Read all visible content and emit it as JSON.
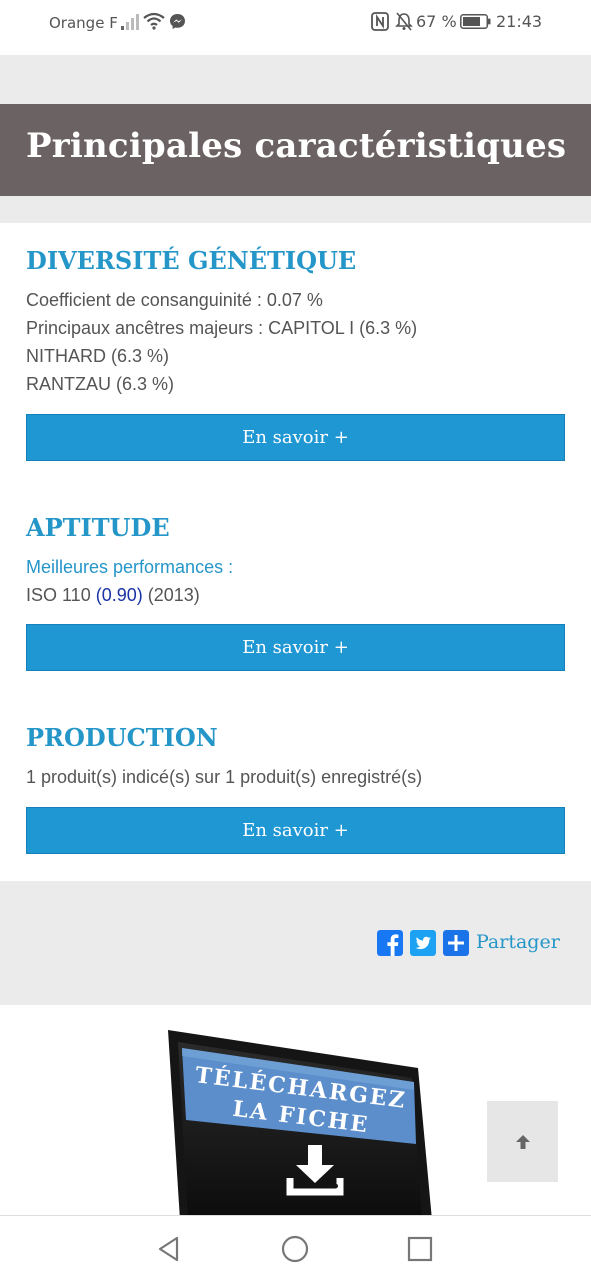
{
  "status_bar": {
    "carrier": "Orange F",
    "battery": "67 %",
    "time": "21:43",
    "icons": [
      "signal-icon",
      "wifi-icon",
      "messenger-icon",
      "nfc-icon",
      "bell-muted-icon",
      "battery-icon"
    ]
  },
  "hero": {
    "title": "Principales caractéristiques"
  },
  "diversity": {
    "title": "DIVERSITÉ GÉNÉTIQUE",
    "coefficient": "Coefficient de consanguinité : 0.07 %",
    "ancestors_label": "Principaux ancêtres majeurs : CAPITOL I (6.3 %)",
    "ancestor_2": "NITHARD (6.3 %)",
    "ancestor_3": "RANTZAU (6.3 %)",
    "button": "En savoir +"
  },
  "aptitude": {
    "title": "APTITUDE",
    "best_label": "Meilleures performances :",
    "perf_prefix": "ISO 110 ",
    "perf_score": "(0.90)",
    "perf_year": " (2013)",
    "button": "En savoir +"
  },
  "production": {
    "title": "PRODUCTION",
    "summary": "1 produit(s) indicé(s) sur 1 produit(s) enregistré(s)",
    "button": "En savoir +"
  },
  "share": {
    "label": "Partager",
    "icons": [
      "facebook-icon",
      "twitter-icon",
      "plus-share-icon"
    ],
    "colors": {
      "facebook": "#1877f2",
      "twitter": "#1da1f2",
      "plus": "#1a73e8"
    }
  },
  "download": {
    "line1": "TÉLÉCHARGEZ",
    "line2": "LA FICHE"
  },
  "colors": {
    "accent": "#2596c8",
    "button": "#1f97d3",
    "hero_bg": "#6b6264"
  }
}
